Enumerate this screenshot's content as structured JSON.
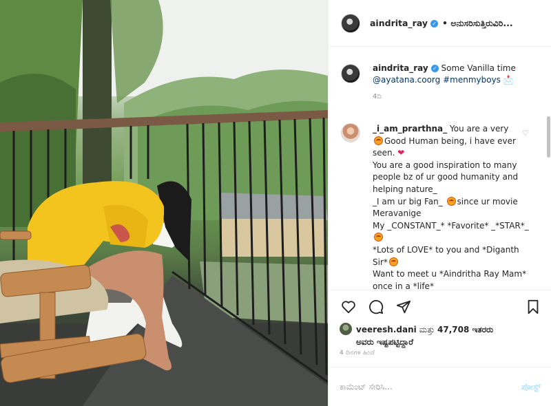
{
  "post": {
    "username": "aindrita_ray",
    "follow_text": "• ಅನುಸರಿಸುತ್ತಿರುವಿರಿ...",
    "verified": true
  },
  "caption": {
    "username": "aindrita_ray",
    "text": "Some Vanilla time",
    "mention": "@ayatana.coorg",
    "hashtag": "#menmyboys",
    "time": "4ದಿ"
  },
  "comment": {
    "username": "_i_am_prarthna_",
    "lines": [
      "You are a very",
      "Good Human being, i have ever seen.",
      "You are a good inspiration to many people bz of ur good humanity and helping nature_",
      "_I am ur big Fan_",
      "since ur movie Meravanige",
      "My _CONSTANT_* *Favorite* _*STAR*_",
      "*Lots of LOVE* to you and *Diganth Sir*",
      "Want to meet u *Aindritha Ray Mam* once in a *life*"
    ]
  },
  "likes": {
    "liker": "veeresh.dani",
    "connector": "ಮತ್ತು",
    "count_text": "47,708 ಇತರರು",
    "line2": "ಅವರು ಇಷ್ಟಪಟ್ಟಿದ್ದಾರೆ"
  },
  "timestamp": "4 ದಿನಗಳ ಹಿಂದೆ",
  "add_comment": {
    "placeholder": "ಕಾಮೆಂಟ್ ಸೇರಿಸಿ...",
    "post_label": "ಪೋಸ್ಟ್"
  },
  "colors": {
    "accent": "#3897f0",
    "link": "#00376b",
    "post_button": "#b2dffc",
    "muted": "#8e8e8e"
  },
  "icons": [
    "heart-icon",
    "comment-icon",
    "share-icon",
    "bookmark-icon",
    "verified-badge-icon",
    "like-comment-icon"
  ]
}
